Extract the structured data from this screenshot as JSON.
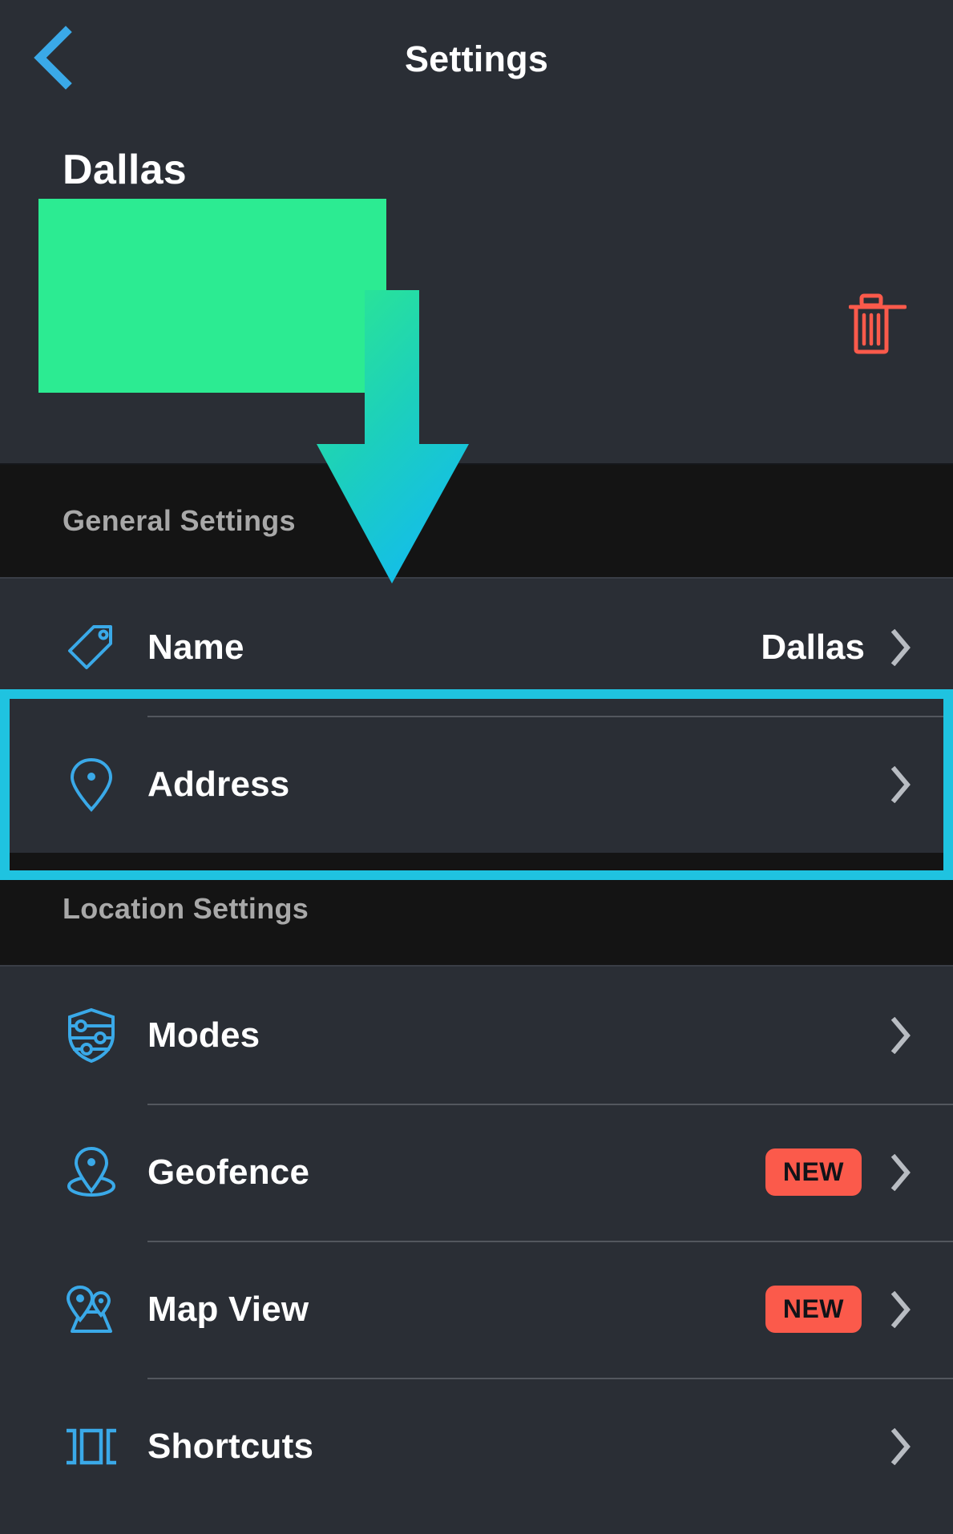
{
  "nav": {
    "back_icon": "chevron-left-icon",
    "title": "Settings"
  },
  "hero": {
    "title": "Dallas",
    "thumbnail_color": "#2ceb92",
    "delete_icon": "trash-icon",
    "delete_icon_color": "#fb5a4b"
  },
  "sections": [
    {
      "header": "General Settings",
      "rows": [
        {
          "icon": "tag-icon",
          "label": "Name",
          "value": "Dallas",
          "badge": null,
          "chevron": "chevron-right-icon"
        },
        {
          "icon": "map-pin-icon",
          "label": "Address",
          "value": "",
          "badge": null,
          "chevron": "chevron-right-icon"
        }
      ]
    },
    {
      "header": "Location Settings",
      "rows": [
        {
          "icon": "shield-sliders-icon",
          "label": "Modes",
          "value": "",
          "badge": null,
          "chevron": "chevron-right-icon"
        },
        {
          "icon": "geofence-pin-icon",
          "label": "Geofence",
          "value": "",
          "badge": "NEW",
          "chevron": "chevron-right-icon"
        },
        {
          "icon": "map-view-icon",
          "label": "Map View",
          "value": "",
          "badge": "NEW",
          "chevron": "chevron-right-icon"
        },
        {
          "icon": "shortcuts-icon",
          "label": "Shortcuts",
          "value": "",
          "badge": null,
          "chevron": "chevron-right-icon"
        }
      ]
    }
  ],
  "annotations": {
    "highlight_target": "Address",
    "highlight_color": "#1fc3e0",
    "arrow_icon": "down-arrow-annotation",
    "arrow_gradient_start": "#2de98e",
    "arrow_gradient_end": "#14bee8"
  },
  "theme": {
    "background": "#2a2e35",
    "section_header_background": "#141414",
    "accent_blue": "#3aa9e8",
    "text_primary": "#ffffff",
    "text_secondary": "#a8a8a8",
    "divider": "#53575e"
  }
}
